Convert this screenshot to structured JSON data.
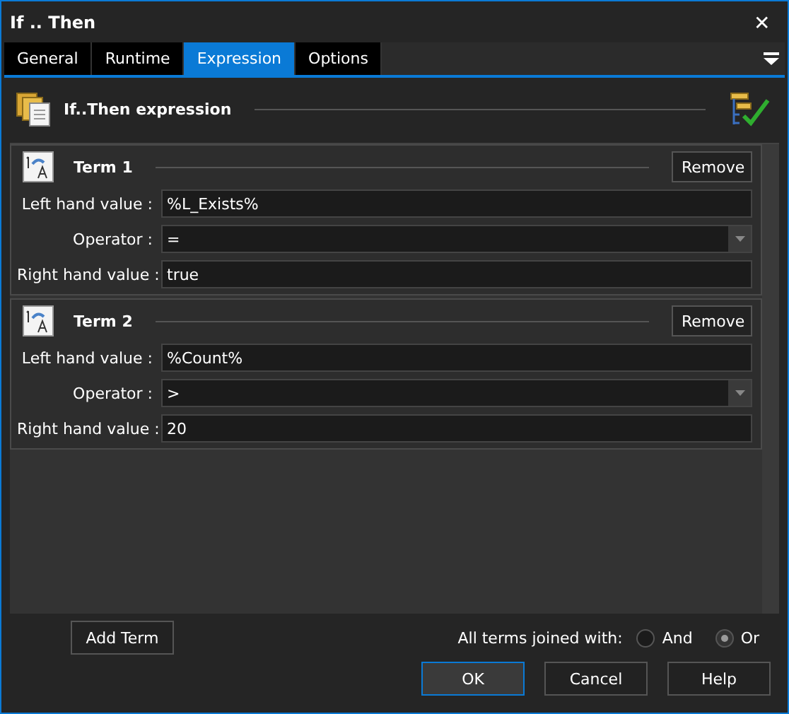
{
  "window": {
    "title": "If .. Then",
    "close": "✕"
  },
  "tabs": [
    {
      "label": "General",
      "selected": false
    },
    {
      "label": "Runtime",
      "selected": false
    },
    {
      "label": "Expression",
      "selected": true
    },
    {
      "label": "Options",
      "selected": false
    }
  ],
  "header": {
    "title": "If..Then expression"
  },
  "terms": [
    {
      "title": "Term 1",
      "remove": "Remove",
      "fields": [
        {
          "label": "Left hand value :",
          "value": "%L_Exists%",
          "kind": "text"
        },
        {
          "label": "Operator :",
          "value": "=",
          "kind": "dropdown"
        },
        {
          "label": "Right hand value :",
          "value": "true",
          "kind": "text"
        }
      ]
    },
    {
      "title": "Term 2",
      "remove": "Remove",
      "fields": [
        {
          "label": "Left hand value :",
          "value": "%Count%",
          "kind": "text"
        },
        {
          "label": "Operator :",
          "value": ">",
          "kind": "dropdown"
        },
        {
          "label": "Right hand value :",
          "value": "20",
          "kind": "text"
        }
      ]
    }
  ],
  "add_term": "Add Term",
  "join": {
    "label": "All terms joined with:",
    "options": [
      {
        "label": "And",
        "selected": false
      },
      {
        "label": "Or",
        "selected": true
      }
    ]
  },
  "buttons": [
    "OK",
    "Cancel",
    "Help"
  ]
}
